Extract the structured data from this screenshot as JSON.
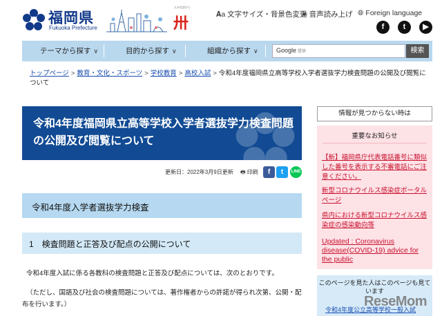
{
  "header": {
    "logo_text": "福岡県",
    "logo_sub": "Fukuoka Prefecture",
    "brand_text": "卅",
    "brand_tiny": "九州北部から",
    "tools": [
      {
        "icon": "font-size-icon",
        "label": "文字サイズ・背景色変更"
      },
      {
        "icon": "speaker-icon",
        "label": "音声読み上げ"
      },
      {
        "icon": "globe-icon",
        "label": "Foreign language"
      }
    ],
    "social": [
      {
        "icon": "facebook-icon",
        "glyph": "f"
      },
      {
        "icon": "twitter-icon",
        "glyph": "t"
      },
      {
        "icon": "youtube-icon",
        "glyph": "▶"
      }
    ]
  },
  "nav": {
    "items": [
      "テーマから探す",
      "目的から探す",
      "組織から探す"
    ],
    "search_brand": "Google",
    "search_sub": "提供",
    "search_button": "検索"
  },
  "breadcrumb": {
    "links": [
      "トップページ",
      "教育・文化・スポーツ",
      "学校教育",
      "高校入試"
    ],
    "current": "令和4年度福岡県立高等学校入学者選抜学力検査問題の公開及び閲覧について"
  },
  "page": {
    "title": "令和4年度福岡県立高等学校入学者選抜学力検査問題の公開及び閲覧について",
    "updated": "更新日：2022年3月9日更新",
    "print": "印刷",
    "share": {
      "facebook": "f",
      "twitter": "t",
      "line": "LINE"
    },
    "h2": "令和4年度入学者選抜学力検査",
    "h3": "1　検査問題と正答及び配点の公開について",
    "p1": "令和4年度入試に係る各教科の検査問題と正答及び配点については、次のとおりです。",
    "p2": "（ただし、国語及び社会の検査問題については、著作権者からの許諾が得られ次第、公開・配布を行います。）"
  },
  "sidebar": {
    "not_found_button": "情報が見つからない時は",
    "notice_title": "重要なお知らせ",
    "notices": [
      "【新】福岡県庁代表電話番号に類似した番号を表示する不審電話にご注意ください。",
      "新型コロナウイルス感染症ポータルページ",
      "県内における新型コロナウイルス感染症の感染動向等",
      "Updated : Coronavirus disease(COVID-19) advice for the public"
    ],
    "recommend_title": "このページを見た人はこのページも見ています",
    "recommend_link": "令和4年度公立高等学校一般入試"
  },
  "watermark": "ReseMom",
  "colors": {
    "brand_blue": "#124b94",
    "nav_bg": "#b9d8ee",
    "notice_bg": "#fde2e6",
    "notice_link": "#c8102e",
    "link": "#1a4fb0"
  }
}
